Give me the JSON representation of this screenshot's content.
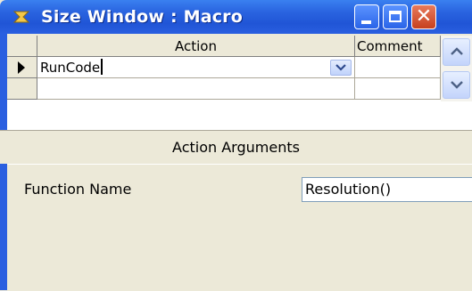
{
  "window": {
    "title": "Size Window : Macro"
  },
  "title_buttons": {
    "minimize_icon": "minimize-icon",
    "maximize_icon": "maximize-icon",
    "close_glyph": "✕"
  },
  "grid": {
    "columns": {
      "action": "Action",
      "comment": "Comment"
    },
    "rows": [
      {
        "action": "RunCode",
        "comment": "",
        "selected": true
      },
      {
        "action": "",
        "comment": ""
      }
    ]
  },
  "arguments": {
    "header": "Action Arguments",
    "function_name_label": "Function Name",
    "function_name_value": "Resolution()"
  },
  "colors": {
    "titlebar": "#2a64e0",
    "close_button": "#c6401e",
    "panel": "#ece9d8"
  }
}
